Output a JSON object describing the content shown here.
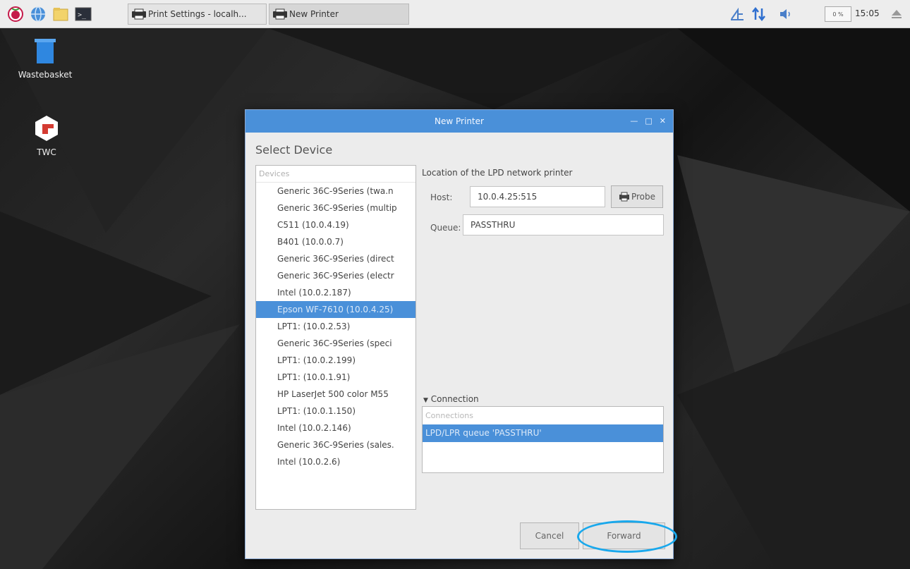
{
  "taskbar": {
    "tasks": [
      {
        "label": "Print Settings - localh..."
      },
      {
        "label": "New Printer"
      }
    ],
    "cpu": "0 %",
    "clock": "15:05"
  },
  "desktop": {
    "icons": [
      {
        "label": "Wastebasket"
      },
      {
        "label": "TWC"
      }
    ]
  },
  "dialog": {
    "title": "New Printer",
    "heading": "Select Device",
    "devices_header": "Devices",
    "devices": [
      "Generic 36C-9Series (twa.n",
      "Generic 36C-9Series (multip",
      "C511  (10.0.4.19)",
      "B401  (10.0.0.7)",
      "Generic 36C-9Series (direct",
      "Generic 36C-9Series (electr",
      "Intel (10.0.2.187)",
      "Epson WF-7610 (10.0.4.25)",
      "LPT1: (10.0.2.53)",
      "Generic 36C-9Series (speci",
      "LPT1: (10.0.2.199)",
      "LPT1: (10.0.1.91)",
      "HP LaserJet 500 color M55",
      "LPT1: (10.0.1.150)",
      "Intel (10.0.2.146)",
      "Generic 36C-9Series (sales.",
      "Intel (10.0.2.6)"
    ],
    "selected_device_index": 7,
    "location_label": "Location of the LPD network printer",
    "host_label": "Host:",
    "host_value": "10.0.4.25:515",
    "probe_label": "Probe",
    "queue_label": "Queue:",
    "queue_value": "PASSTHRU",
    "connection_label": "Connection",
    "connections_header": "Connections",
    "connection_item": "LPD/LPR queue 'PASSTHRU'",
    "cancel_label": "Cancel",
    "forward_label": "Forward"
  },
  "colors": {
    "accent": "#4a90d9",
    "highlight_ring": "#19a8ec"
  }
}
